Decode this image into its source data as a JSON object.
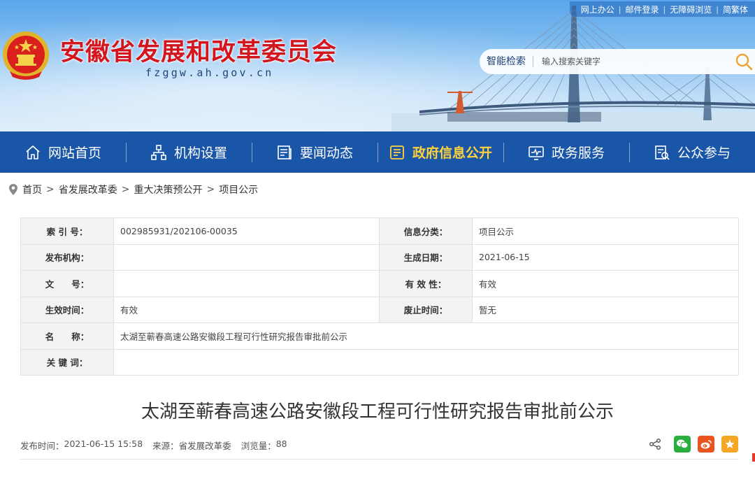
{
  "top_links": [
    "网上办公",
    "邮件登录",
    "无障碍浏览",
    "简繁体"
  ],
  "site": {
    "title": "安徽省发展和改革委员会",
    "domain": "fzggw.ah.gov.cn"
  },
  "search": {
    "label": "智能检索",
    "placeholder": "输入搜索关键字"
  },
  "nav": [
    {
      "label": "网站首页",
      "icon": "home-icon"
    },
    {
      "label": "机构设置",
      "icon": "org-chart-icon"
    },
    {
      "label": "要闻动态",
      "icon": "news-icon"
    },
    {
      "label": "政府信息公开",
      "icon": "info-disclosure-icon",
      "active": true
    },
    {
      "label": "政务服务",
      "icon": "monitor-icon"
    },
    {
      "label": "公众参与",
      "icon": "participation-icon"
    }
  ],
  "breadcrumb": [
    "首页",
    "省发展改革委",
    "重大决策预公开",
    "项目公示"
  ],
  "info": {
    "index_label": "索 引 号：",
    "index_value": "002985931/202106-00035",
    "category_label": "信息分类：",
    "category_value": "项目公示",
    "publisher_label": "发布机构：",
    "publisher_value": "",
    "date_label": "生成日期：",
    "date_value": "2021-06-15",
    "docno_label": "文　　号：",
    "docno_value": "",
    "validity_label": "有 效 性：",
    "validity_value": "有效",
    "effective_label": "生效时间：",
    "effective_value": "有效",
    "expire_label": "废止时间：",
    "expire_value": "暂无",
    "name_label": "名　　称：",
    "name_value": "太湖至蕲春高速公路安徽段工程可行性研究报告审批前公示",
    "keywords_label": "关 键 词：",
    "keywords_value": ""
  },
  "article": {
    "title": "太湖至蕲春高速公路安徽段工程可行性研究报告审批前公示",
    "publish_time_label": "发布时间：",
    "publish_time": "2021-06-15 15:58",
    "source_label": "来源：",
    "source": "省发展改革委",
    "views_label": "浏览量：",
    "views": "88"
  },
  "share_icons": [
    "share-icon",
    "wechat-icon",
    "weibo-icon",
    "favorite-icon"
  ],
  "colors": {
    "nav_bg": "#1a56a8",
    "nav_active": "#ffd23a",
    "title_red": "#d3161e",
    "wechat": "#2aae3e",
    "weibo": "#e9541e",
    "favorite": "#f5a623"
  }
}
